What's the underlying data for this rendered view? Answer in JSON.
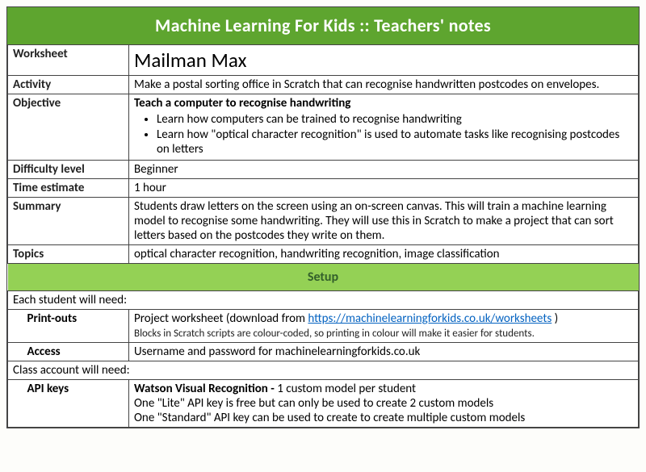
{
  "header": {
    "title": "Machine Learning For Kids  ::  Teachers' notes"
  },
  "rows": {
    "worksheet": {
      "label": "Worksheet",
      "value": "Mailman Max"
    },
    "activity": {
      "label": "Activity",
      "value": "Make a postal sorting office in Scratch that can recognise handwritten postcodes on envelopes."
    },
    "objective": {
      "label": "Objective",
      "heading": "Teach a computer to recognise handwriting",
      "bullets": [
        "Learn how computers can be trained to recognise handwriting",
        "Learn how \"optical character recognition\" is used to automate tasks like recognising postcodes on letters"
      ]
    },
    "difficulty": {
      "label": "Difficulty level",
      "value": "Beginner"
    },
    "time": {
      "label": "Time estimate",
      "value": "1 hour"
    },
    "summary": {
      "label": "Summary",
      "value": "Students draw letters on the screen using an on-screen canvas. This will train a machine learning model to recognise some handwriting. They will use this in Scratch to make a project that can sort letters based on the postcodes they write on them."
    },
    "topics": {
      "label": "Topics",
      "value": "optical character recognition, handwriting recognition, image classification"
    }
  },
  "setup": {
    "heading": "Setup",
    "student_lead": "Each student will need:",
    "printouts": {
      "label": "Print-outs",
      "text_a": "Project worksheet    (download from ",
      "link": "https://machinelearningforkids.co.uk/worksheets",
      "text_b": " )",
      "note": "Blocks in Scratch scripts are colour-coded, so printing in colour will make it easier for students."
    },
    "access": {
      "label": "Access",
      "value": "Username and password for machinelearningforkids.co.uk"
    },
    "class_lead": "Class account will need:",
    "api": {
      "label": "API keys",
      "head": "Watson Visual Recognition  - ",
      "head_tail": "1 custom model per student",
      "line2": "One \"Lite\" API key is free but can only be used to create 2 custom models",
      "line3": "One \"Standard\" API key can be used to create to create multiple custom models"
    }
  }
}
